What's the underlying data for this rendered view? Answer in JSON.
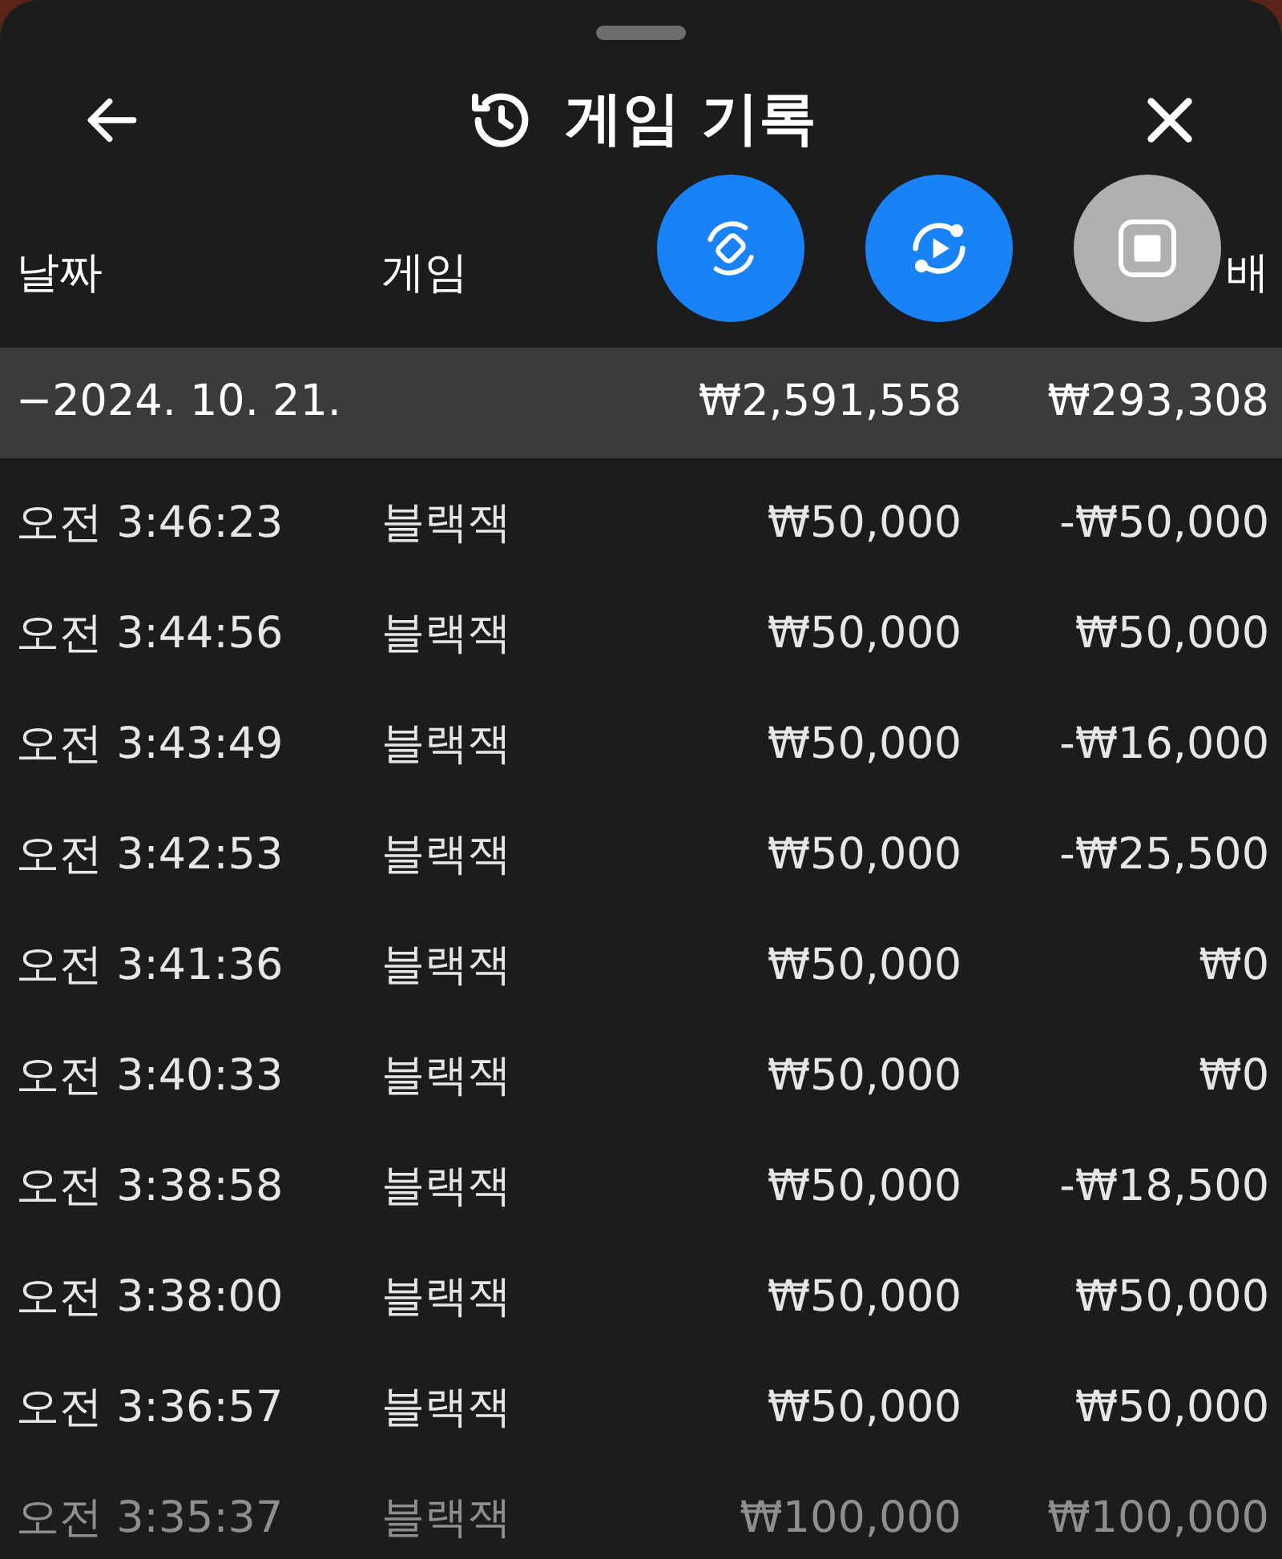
{
  "title": "게임 기록",
  "columns": [
    {
      "label": "날짜"
    },
    {
      "label": "게임"
    },
    {
      "label": "배"
    }
  ],
  "floating_buttons": [
    {
      "kind": "rotate"
    },
    {
      "kind": "replay"
    },
    {
      "kind": "stop"
    }
  ],
  "summary": {
    "date": "−2024. 10. 21.",
    "bet": "₩2,591,558",
    "payout": "₩293,308"
  },
  "rows": [
    {
      "time": "오전 3:46:23",
      "game": "블랙잭",
      "bet": "₩50,000",
      "payout": "-₩50,000",
      "dimmed": false
    },
    {
      "time": "오전 3:44:56",
      "game": "블랙잭",
      "bet": "₩50,000",
      "payout": "₩50,000",
      "dimmed": false
    },
    {
      "time": "오전 3:43:49",
      "game": "블랙잭",
      "bet": "₩50,000",
      "payout": "-₩16,000",
      "dimmed": false
    },
    {
      "time": "오전 3:42:53",
      "game": "블랙잭",
      "bet": "₩50,000",
      "payout": "-₩25,500",
      "dimmed": false
    },
    {
      "time": "오전 3:41:36",
      "game": "블랙잭",
      "bet": "₩50,000",
      "payout": "₩0",
      "dimmed": false
    },
    {
      "time": "오전 3:40:33",
      "game": "블랙잭",
      "bet": "₩50,000",
      "payout": "₩0",
      "dimmed": false
    },
    {
      "time": "오전 3:38:58",
      "game": "블랙잭",
      "bet": "₩50,000",
      "payout": "-₩18,500",
      "dimmed": false
    },
    {
      "time": "오전 3:38:00",
      "game": "블랙잭",
      "bet": "₩50,000",
      "payout": "₩50,000",
      "dimmed": false
    },
    {
      "time": "오전 3:36:57",
      "game": "블랙잭",
      "bet": "₩50,000",
      "payout": "₩50,000",
      "dimmed": false
    },
    {
      "time": "오전 3:35:37",
      "game": "블랙잭",
      "bet": "₩100,000",
      "payout": "₩100,000",
      "dimmed": true
    }
  ]
}
